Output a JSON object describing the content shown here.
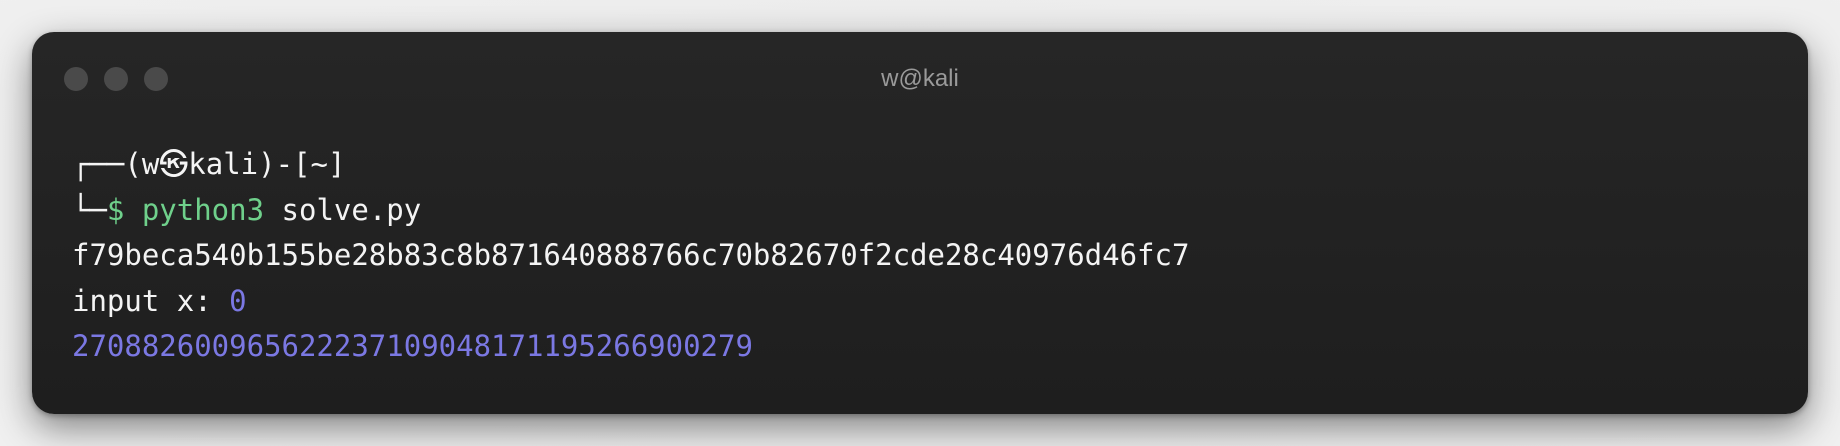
{
  "window": {
    "title": "w@kali"
  },
  "terminal": {
    "prompt_top": "┌──(w㉿kali)-[~]",
    "prompt_prefix": "└─$ ",
    "command": "python3",
    "command_args": " solve.py",
    "output_hash": "f79beca540b155be28b83c8b871640888766c70b82670f2cde28c40976d46fc7",
    "input_label": "input x: ",
    "input_value": "0",
    "result": "27088260096562223710904817119526690027​9"
  },
  "colors": {
    "command": "#6fd08b",
    "value": "#7b78e3",
    "text": "#f4f4f4",
    "background": "#1e1e1e"
  }
}
